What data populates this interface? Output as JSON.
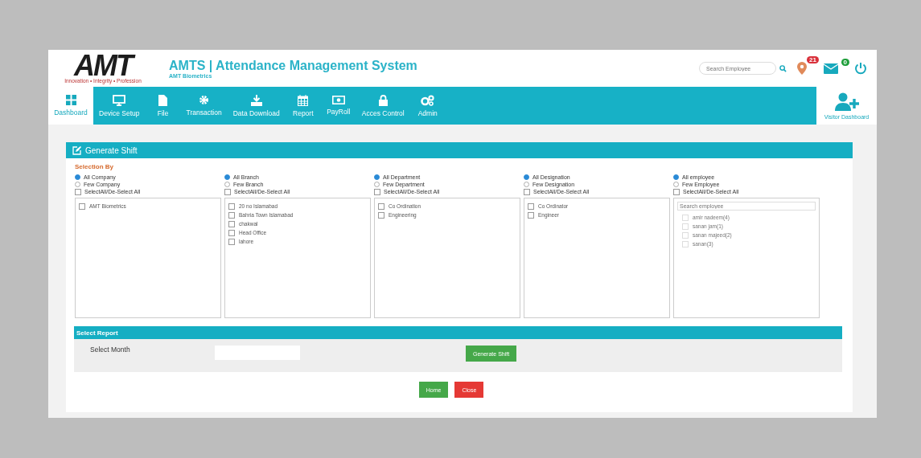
{
  "header": {
    "logo": "AMT",
    "logo_tagline": "Innovation • Integrity • Profession",
    "title": "AMTS | Attendance Management System",
    "subtitle": "AMT Biometrics",
    "search": {
      "placeholder": "Search Employee"
    },
    "notifications_badge": "21",
    "mail_badge": "0"
  },
  "nav": [
    {
      "label": "Dashboard",
      "kind": "grid",
      "selected": true
    },
    {
      "label": "Device Setup",
      "kind": "monitor",
      "selected": false
    },
    {
      "label": "File",
      "kind": "file",
      "selected": false
    },
    {
      "label": "Transaction",
      "kind": "gear",
      "selected": false
    },
    {
      "label": "Data Download",
      "kind": "download",
      "selected": false
    },
    {
      "label": "Report",
      "kind": "calendar",
      "selected": false
    },
    {
      "label": "PayRoll",
      "kind": "money",
      "selected": false
    },
    {
      "label": "Acces Control",
      "kind": "lock",
      "selected": false
    },
    {
      "label": "Admin",
      "kind": "gears",
      "selected": false
    }
  ],
  "visitor_dashboard": "Visitor Dashboard",
  "panel": {
    "title": "Generate Shift",
    "section": "Selection By",
    "columns": [
      {
        "kind": "list",
        "radios": [
          {
            "label": "All Company",
            "selected": true
          },
          {
            "label": "Few Company",
            "selected": false
          }
        ],
        "select_all": {
          "label": "SelectAll/De-Select All",
          "checked": false
        },
        "items": [
          {
            "label": "AMT Biometrics",
            "checked": false
          }
        ]
      },
      {
        "kind": "list",
        "radios": [
          {
            "label": "All Branch",
            "selected": true
          },
          {
            "label": "Few Branch",
            "selected": false
          }
        ],
        "select_all": {
          "label": "SelectAll/De-Select All",
          "checked": false
        },
        "items": [
          {
            "label": "20 no Islamabad",
            "checked": false
          },
          {
            "label": "Bahria Town Islamabad",
            "checked": false
          },
          {
            "label": "chakwal",
            "checked": false
          },
          {
            "label": "Head Office",
            "checked": false
          },
          {
            "label": "lahore",
            "checked": false
          }
        ]
      },
      {
        "kind": "list",
        "radios": [
          {
            "label": "All Department",
            "selected": true
          },
          {
            "label": "Few Department",
            "selected": false
          }
        ],
        "select_all": {
          "label": "SelectAll/De-Select All",
          "checked": false
        },
        "items": [
          {
            "label": "Co Ordination",
            "checked": false
          },
          {
            "label": "Engineering",
            "checked": false
          }
        ]
      },
      {
        "kind": "list",
        "radios": [
          {
            "label": "All Designation",
            "selected": true
          },
          {
            "label": "Few Designation",
            "selected": false
          }
        ],
        "select_all": {
          "label": "SelectAll/De-Select All",
          "checked": false
        },
        "items": [
          {
            "label": "Co Ordinator",
            "checked": false
          },
          {
            "label": "Engineer",
            "checked": false
          }
        ]
      },
      {
        "kind": "search",
        "search_placeholder": "Search employee",
        "radios": [
          {
            "label": "All employee",
            "selected": true
          },
          {
            "label": "Few Employee",
            "selected": false
          }
        ],
        "select_all": {
          "label": "SelectAll/De-Select All",
          "checked": false
        },
        "items": [
          {
            "label": "amir nadeem(4)",
            "checked": false
          },
          {
            "label": "sanan jam(1)",
            "checked": false
          },
          {
            "label": "sanan majeed(2)",
            "checked": false
          },
          {
            "label": "sanan(3)",
            "checked": false
          }
        ]
      }
    ]
  },
  "report": {
    "title": "Select Report",
    "month_label": "Select Month",
    "generate_button": "Generate Shift"
  },
  "footer_buttons": [
    {
      "label": "Home",
      "kind": "primary"
    },
    {
      "label": "Close",
      "kind": "danger"
    }
  ]
}
